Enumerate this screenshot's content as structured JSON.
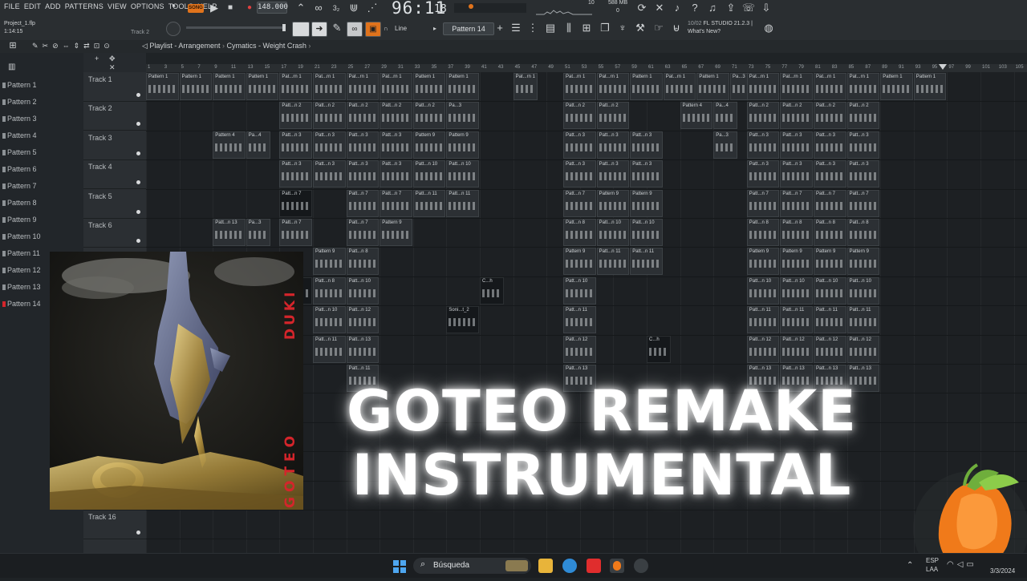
{
  "menu": [
    "FILE",
    "EDIT",
    "ADD",
    "PATTERNS",
    "VIEW",
    "OPTIONS",
    "TOOLS",
    "HELP"
  ],
  "song_mode": "SONG",
  "tempo": "148.000",
  "time_main": "96:11",
  "time_sub": "18",
  "cpu_top": "10",
  "memory": "588 MB",
  "memory_sub": "0",
  "project_name": "Project_1.flp",
  "project_time": "1:14:15",
  "current_track_hint": "Track 2",
  "snap_mode": "Line",
  "pattern_selector": "Pattern 14",
  "news": {
    "date": "10/02",
    "product": "FL STUDIO 21.2.3 |",
    "link": "What's New?"
  },
  "breadcrumb": {
    "view": "Playlist - Arrangement",
    "item": "Cymatics - Weight Crash"
  },
  "patterns": [
    "Pattern 1",
    "Pattern 2",
    "Pattern 3",
    "Pattern 4",
    "Pattern 5",
    "Pattern 6",
    "Pattern 7",
    "Pattern 8",
    "Pattern 9",
    "Pattern 10",
    "Pattern 11",
    "Pattern 12",
    "Pattern 13",
    "Pattern 14"
  ],
  "tracks": [
    "Track 1",
    "Track 2",
    "Track 3",
    "Track 4",
    "Track 5",
    "Track 6"
  ],
  "track_bottom": "Track 16",
  "ruler_numbers": [
    "1",
    "3",
    "5",
    "7",
    "9",
    "11",
    "13",
    "15",
    "17",
    "19",
    "21",
    "23",
    "25",
    "27",
    "29",
    "31",
    "33",
    "35",
    "37",
    "39",
    "41",
    "43",
    "45",
    "47",
    "49",
    "51",
    "53",
    "55",
    "57",
    "59",
    "61",
    "63",
    "65",
    "67",
    "69",
    "71",
    "73",
    "75",
    "77",
    "79",
    "81",
    "83",
    "85",
    "87",
    "89",
    "91",
    "93",
    "95",
    "97",
    "99",
    "101",
    "103",
    "105"
  ],
  "clip_labels": {
    "p1": "Pattern 1",
    "pm1": "Pat...rn 1",
    "p2": "Patt...n 2",
    "pa3": "Pa...3",
    "p4": "Pattern 4",
    "pa4": "Pa...4",
    "p3": "Patt...n 3",
    "p9": "Pattern 9",
    "p10": "Patt...n 10",
    "p7": "Patt...n 7",
    "p11": "Patt...n 11",
    "p13": "Patt...n 13",
    "p8": "Patt...n 8",
    "p8b": "Pattern 8",
    "p12": "Patt...n 12",
    "soni": "Soni...t_2",
    "ch": "C...h"
  },
  "album": {
    "artist": "DUKI",
    "title": "GOTEO"
  },
  "headline": {
    "line1": "GOTEO REMAKE",
    "line2": "INSTRUMENTAL"
  },
  "taskbar": {
    "search": "Búsqueda",
    "lang": "ESP",
    "lang2": "LAA",
    "date": "3/3/2024"
  },
  "colors": {
    "accent_red": "#d4252b",
    "fl_orange": "#f07a1a",
    "bg": "#1d2023"
  }
}
